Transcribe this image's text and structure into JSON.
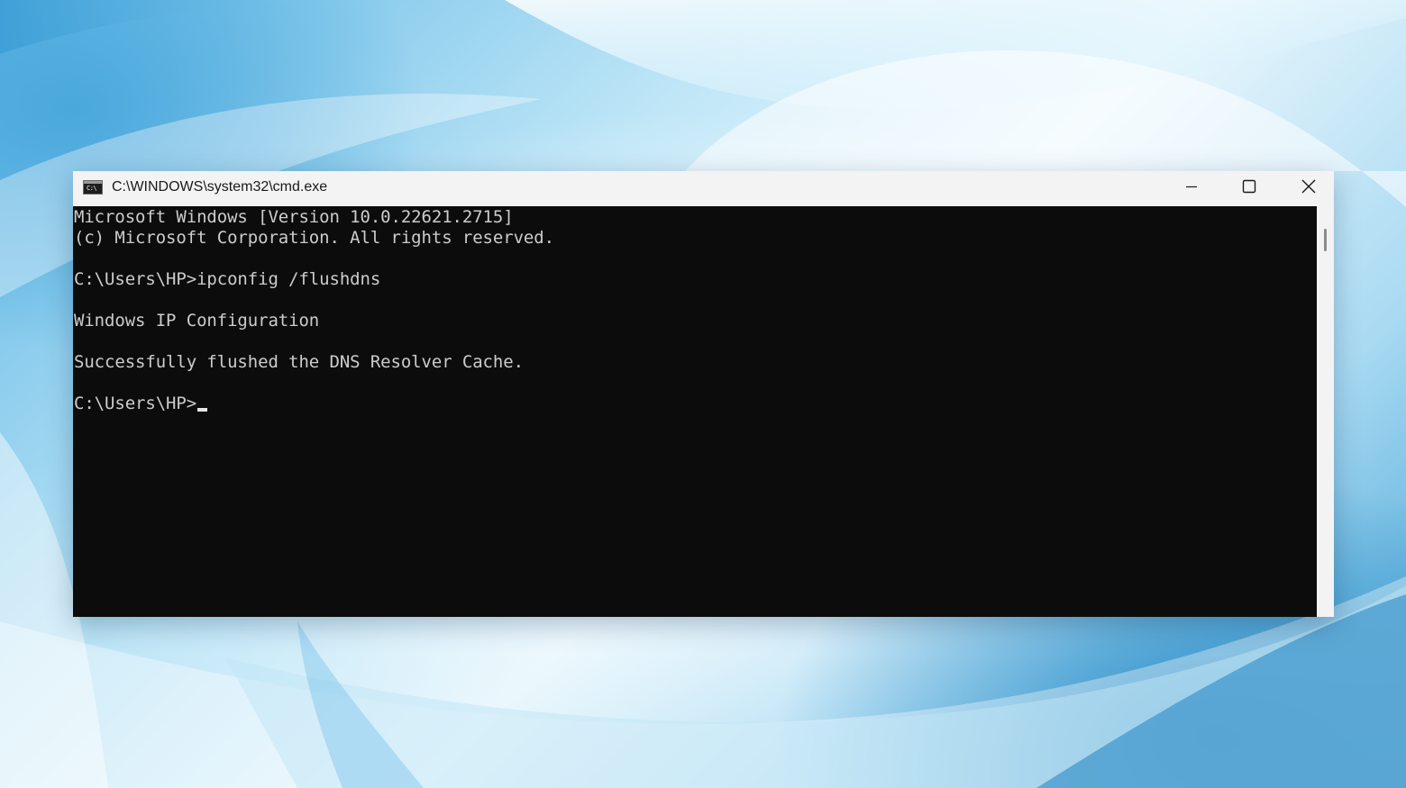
{
  "window": {
    "title": "C:\\WINDOWS\\system32\\cmd.exe",
    "app_icon": "cmd-icon",
    "app_icon_text": "C:\\",
    "controls": {
      "minimize_icon": "minimize-icon",
      "maximize_icon": "maximize-icon",
      "close_icon": "close-icon"
    }
  },
  "console": {
    "lines": [
      "Microsoft Windows [Version 10.0.22621.2715]",
      "(c) Microsoft Corporation. All rights reserved.",
      "",
      "C:\\Users\\HP>ipconfig /flushdns",
      "",
      "Windows IP Configuration",
      "",
      "Successfully flushed the DNS Resolver Cache.",
      "",
      "C:\\Users\\HP>"
    ],
    "background_color": "#0c0c0c",
    "text_color": "#cccccc"
  },
  "colors": {
    "titlebar": "#f3f3f3",
    "wallpaper_accent": "#3f9fd3"
  }
}
